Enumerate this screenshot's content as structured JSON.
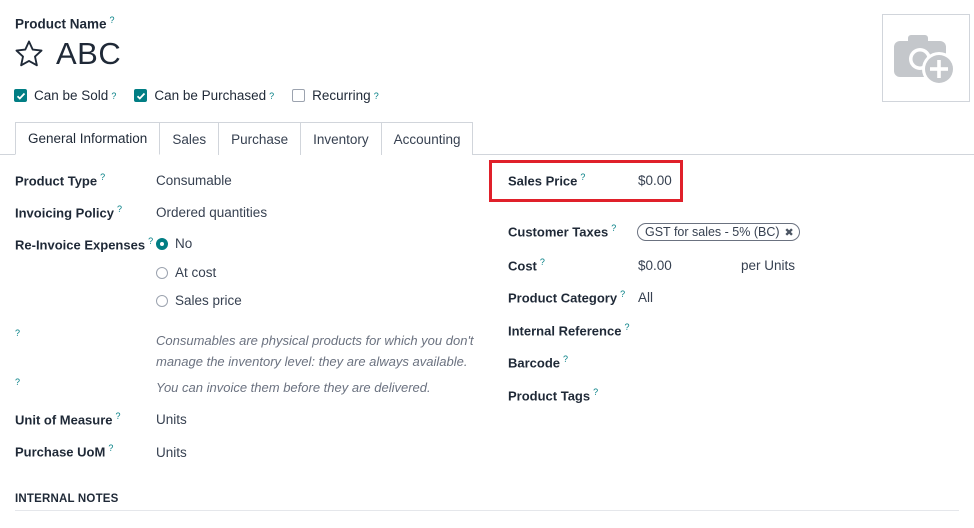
{
  "header": {
    "product_name_label": "Product Name",
    "help": "?",
    "product_name": "ABC"
  },
  "checkboxes": [
    {
      "label": "Can be Sold",
      "checked": true
    },
    {
      "label": "Can be Purchased",
      "checked": true
    },
    {
      "label": "Recurring",
      "checked": false
    }
  ],
  "tabs": [
    "General Information",
    "Sales",
    "Purchase",
    "Inventory",
    "Accounting"
  ],
  "left": {
    "product_type_label": "Product Type",
    "product_type_value": "Consumable",
    "invoicing_policy_label": "Invoicing Policy",
    "invoicing_policy_value": "Ordered quantities",
    "reinvoice_label": "Re-Invoice Expenses",
    "reinvoice_options": [
      "No",
      "At cost",
      "Sales price"
    ],
    "note1_line1": "Consumables are physical products for which you don't",
    "note1_line2": "manage the inventory level: they are always available.",
    "note2": "You can invoice them before they are delivered.",
    "uom_label": "Unit of Measure",
    "uom_value": "Units",
    "purchase_uom_label": "Purchase UoM",
    "purchase_uom_value": "Units"
  },
  "right": {
    "sales_price_label": "Sales Price",
    "sales_price_value": "$0.00",
    "customer_taxes_label": "Customer Taxes",
    "customer_tax_tag": "GST for sales - 5% (BC)",
    "cost_label": "Cost",
    "cost_value": "$0.00",
    "cost_unit": "per Units",
    "category_label": "Product Category",
    "category_value": "All",
    "internal_ref_label": "Internal Reference",
    "barcode_label": "Barcode",
    "tags_label": "Product Tags"
  },
  "internal_notes_label": "INTERNAL NOTES",
  "colors": {
    "accent": "#017e84",
    "highlight": "#e0202a"
  }
}
